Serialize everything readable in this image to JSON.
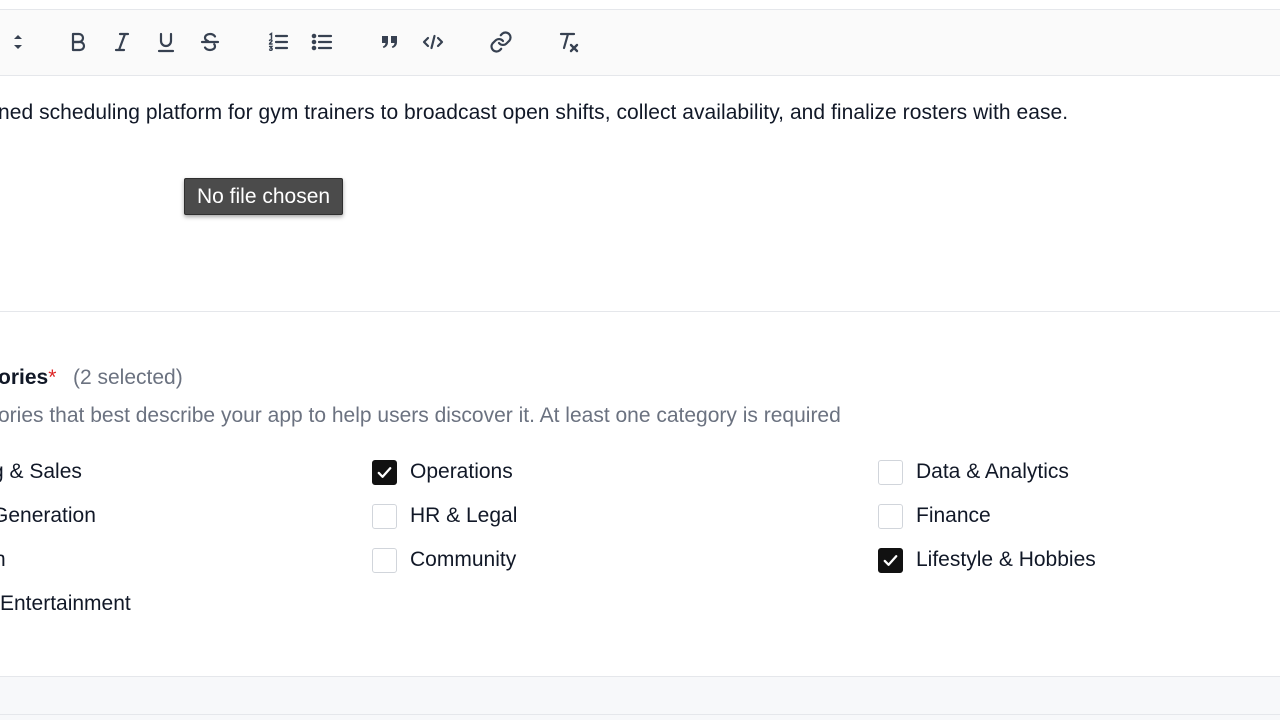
{
  "editor": {
    "content": "ned scheduling platform for gym trainers to broadcast open shifts, collect availability, and finalize rosters with ease.",
    "file_tooltip": "No file chosen"
  },
  "toolbar": {
    "buttons": [
      {
        "name": "heading-select",
        "icon": "sort-arrows-icon"
      },
      {
        "name": "bold",
        "icon": "bold-icon"
      },
      {
        "name": "italic",
        "icon": "italic-icon"
      },
      {
        "name": "underline",
        "icon": "underline-icon"
      },
      {
        "name": "strikethrough",
        "icon": "strikethrough-icon"
      },
      {
        "name": "ordered-list",
        "icon": "ordered-list-icon"
      },
      {
        "name": "bullet-list",
        "icon": "bullet-list-icon"
      },
      {
        "name": "blockquote",
        "icon": "quote-icon"
      },
      {
        "name": "code",
        "icon": "code-icon"
      },
      {
        "name": "link",
        "icon": "link-icon"
      },
      {
        "name": "clear-format",
        "icon": "clear-format-icon"
      }
    ]
  },
  "categories": {
    "title": "ories",
    "required_mark": "*",
    "selected_count": "(2 selected)",
    "description": "ories that best describe your app to help users discover it. At least one category is required",
    "options": [
      {
        "label": "g & Sales",
        "checked": false
      },
      {
        "label": "Generation",
        "checked": false
      },
      {
        "label": "n",
        "checked": false
      },
      {
        "label": "Entertainment",
        "checked": false
      },
      {
        "label": "Operations",
        "checked": true
      },
      {
        "label": "HR & Legal",
        "checked": false
      },
      {
        "label": "Community",
        "checked": false
      },
      {
        "label": "Data & Analytics",
        "checked": false
      },
      {
        "label": "Finance",
        "checked": false
      },
      {
        "label": "Lifestyle & Hobbies",
        "checked": true
      }
    ]
  },
  "colors": {
    "accent": "#111111",
    "required": "#dc2626",
    "muted_text": "#6b7280",
    "tooltip_bg": "#4b4b4b"
  }
}
